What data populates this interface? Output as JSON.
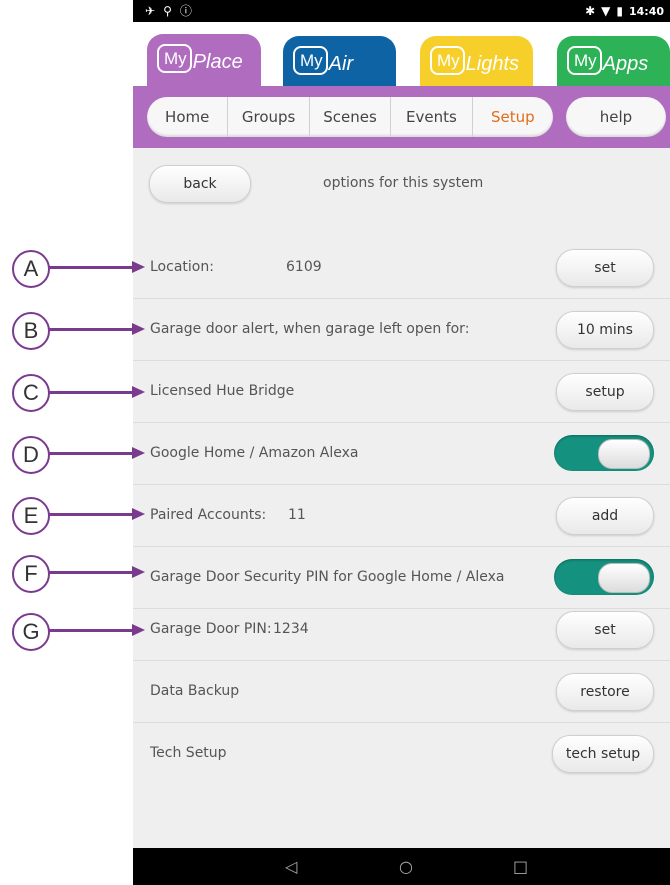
{
  "status_bar": {
    "left_icons": [
      "airplane-signal-icon",
      "usb-icon",
      "info-icon"
    ],
    "time": "14:40",
    "right_icons": [
      "bluetooth-icon",
      "wifi-icon",
      "battery-icon"
    ]
  },
  "app_tabs": [
    {
      "brand": "My",
      "name": "Place",
      "color": "#b06cbf"
    },
    {
      "brand": "My",
      "name": "Air",
      "color": "#0e63a4"
    },
    {
      "brand": "My",
      "name": "Lights",
      "color": "#f7cf2a"
    },
    {
      "brand": "My",
      "name": "Apps",
      "color": "#2db258"
    }
  ],
  "nav": {
    "tabs": [
      "Home",
      "Groups",
      "Scenes",
      "Events",
      "Setup"
    ],
    "active_tab": "Setup",
    "help_label": "help"
  },
  "header": {
    "back_label": "back",
    "title": "options for this system"
  },
  "rows": [
    {
      "label": "Location:",
      "value": "6109",
      "control": "button",
      "button_label": "set"
    },
    {
      "label": "Garage door alert, when garage left open for:",
      "control": "button",
      "button_label": "10 mins"
    },
    {
      "label": "Licensed Hue Bridge",
      "control": "button",
      "button_label": "setup"
    },
    {
      "label": "Google Home / Amazon Alexa",
      "control": "toggle",
      "on": true
    },
    {
      "label": "Paired Accounts:",
      "value": "11",
      "control": "button",
      "button_label": "add"
    },
    {
      "label": "Garage Door Security PIN for Google Home / Alexa",
      "control": "toggle",
      "on": true
    },
    {
      "label": "Garage Door PIN:",
      "value": "1234",
      "control": "button",
      "button_label": "set"
    },
    {
      "label": "Data Backup",
      "control": "button",
      "button_label": "restore"
    },
    {
      "label": "Tech Setup",
      "control": "button",
      "button_label": "tech setup"
    }
  ],
  "callouts": [
    "A",
    "B",
    "C",
    "D",
    "E",
    "F",
    "G"
  ],
  "bottom_nav": {
    "back": "◁",
    "home": "○",
    "recents": "□"
  },
  "colors": {
    "accent_purple": "#b06cbf",
    "active_tab_orange": "#e06d1c",
    "toggle_teal": "#14917f",
    "callout_purple": "#7a3b8f"
  }
}
